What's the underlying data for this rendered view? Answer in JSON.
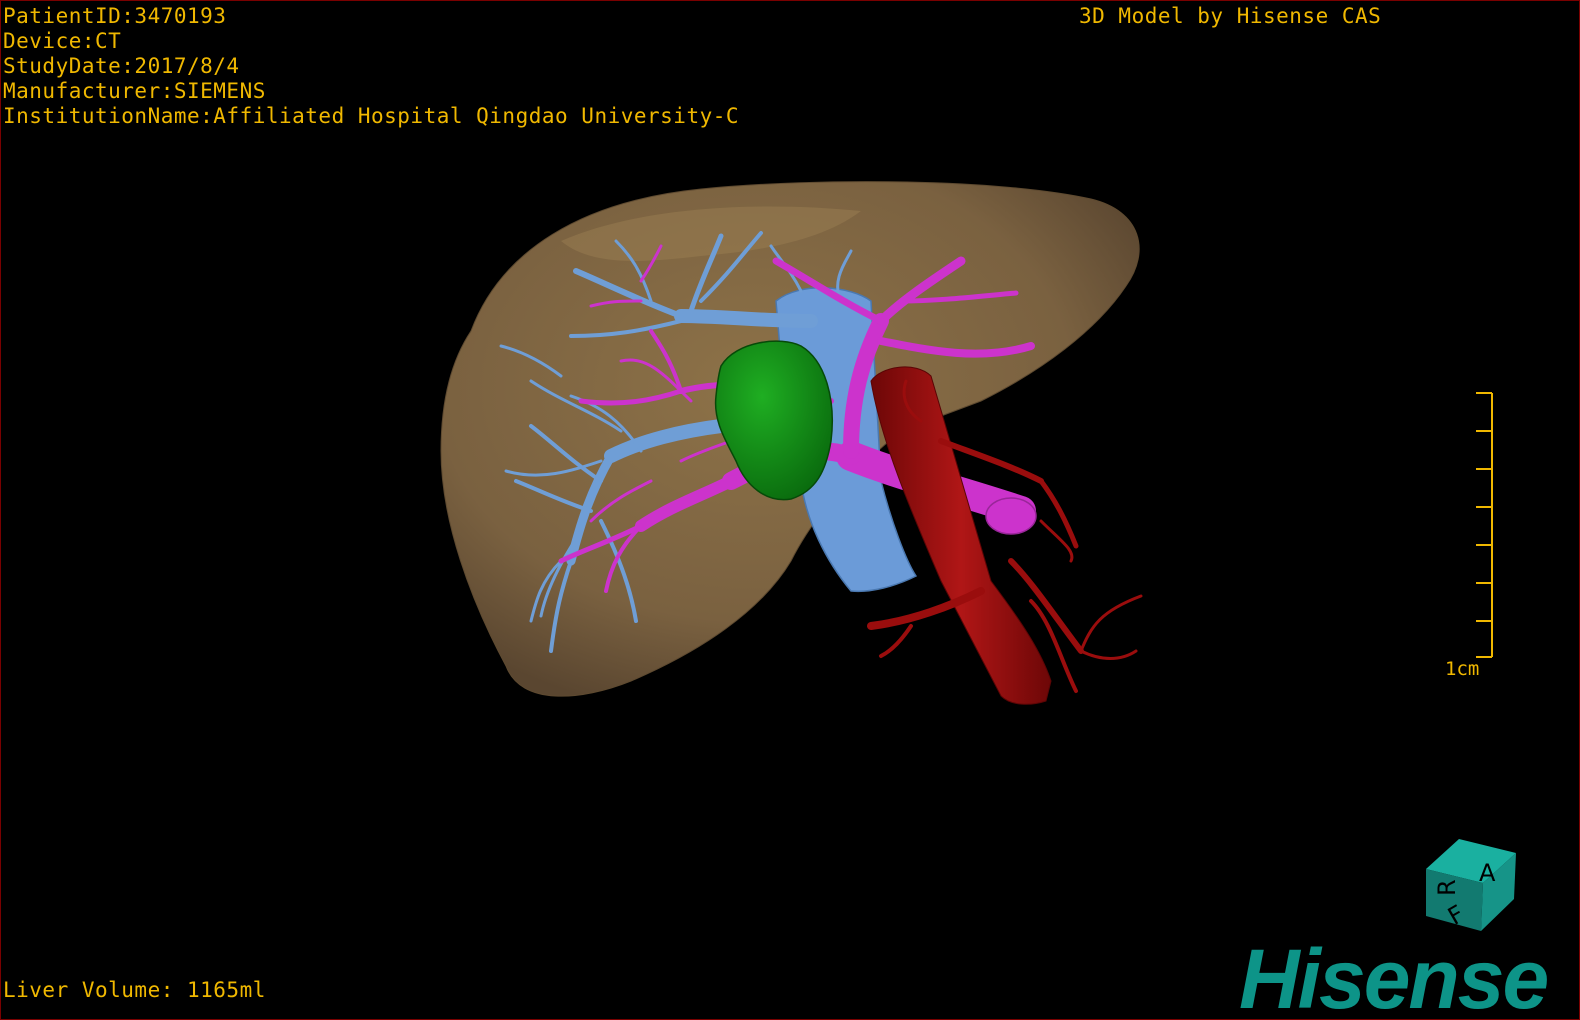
{
  "overlay": {
    "patient_id": "PatientID:3470193",
    "device": "Device:CT",
    "study_date": "StudyDate:2017/8/4",
    "manufacturer": "Manufacturer:SIEMENS",
    "institution": "InstitutionName:Affiliated Hospital Qingdao University-C",
    "model_credit": "3D Model by Hisense CAS",
    "liver_volume": "Liver Volume: 1165ml"
  },
  "scale_bar": {
    "label": "1cm"
  },
  "orientation_cube": {
    "labels": [
      "A",
      "R",
      "F"
    ]
  },
  "brand": {
    "logo_text": "Hisense"
  },
  "colors": {
    "overlay_text": "#f0b800",
    "liver": "#7d6440",
    "hepatic_vein": "#6f9ed6",
    "portal_vein": "#cc33cc",
    "tumor": "#0c8a12",
    "ivc": "#6b9bd8",
    "aorta": "#9a0d0d",
    "brand": "#0d9488"
  }
}
